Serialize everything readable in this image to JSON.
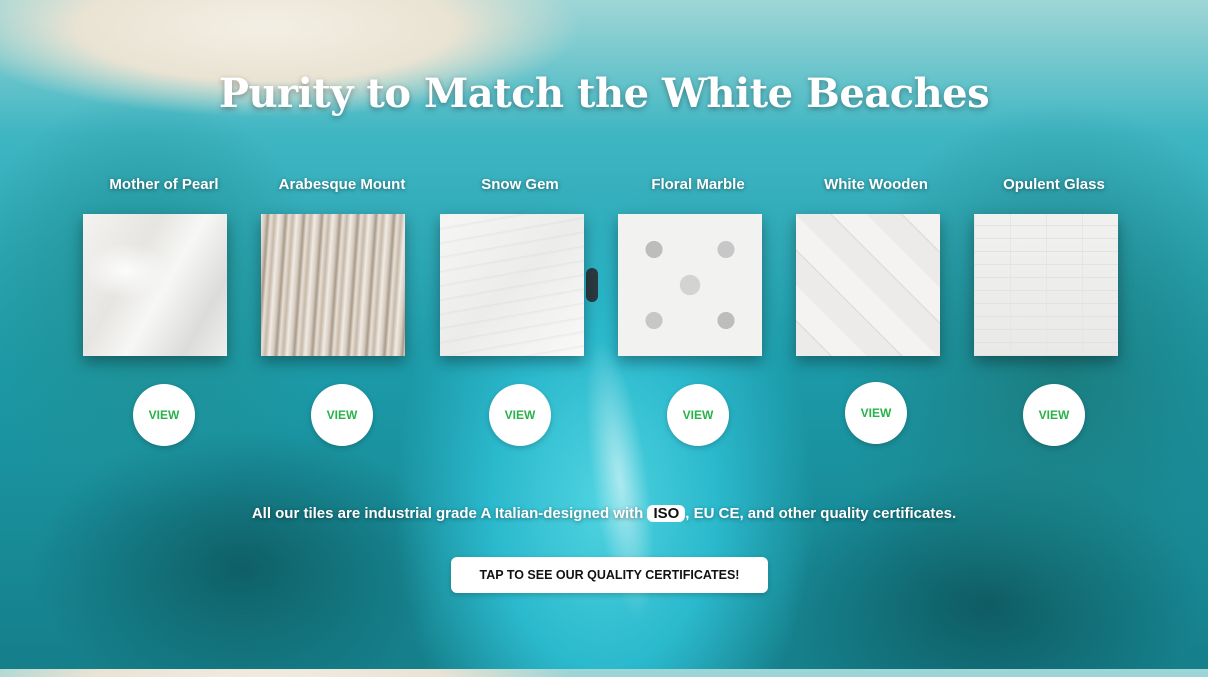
{
  "headline": "Purity to Match the White Beaches",
  "tiles": [
    {
      "name": "Mother of Pearl",
      "view_label": "VIEW",
      "texture": "pearl-marble"
    },
    {
      "name": "Arabesque Mount",
      "view_label": "VIEW",
      "texture": "arabesque-stripes"
    },
    {
      "name": "Snow Gem",
      "view_label": "VIEW",
      "texture": "snow-marble"
    },
    {
      "name": "Floral Marble",
      "view_label": "VIEW",
      "texture": "floral-mosaic"
    },
    {
      "name": "White Wooden",
      "view_label": "VIEW",
      "texture": "herringbone-wood"
    },
    {
      "name": "Opulent Glass",
      "view_label": "VIEW",
      "texture": "glass-subway"
    }
  ],
  "info": {
    "before": "All our tiles are industrial grade A Italian-designed with ",
    "badge": "ISO",
    "after": ", EU CE, and other quality certificates."
  },
  "cert_button_label": "TAP TO SEE OUR QUALITY CERTIFICATES!",
  "colors": {
    "view_text": "#27b24a",
    "button_bg": "#ffffff",
    "text": "#ffffff"
  }
}
